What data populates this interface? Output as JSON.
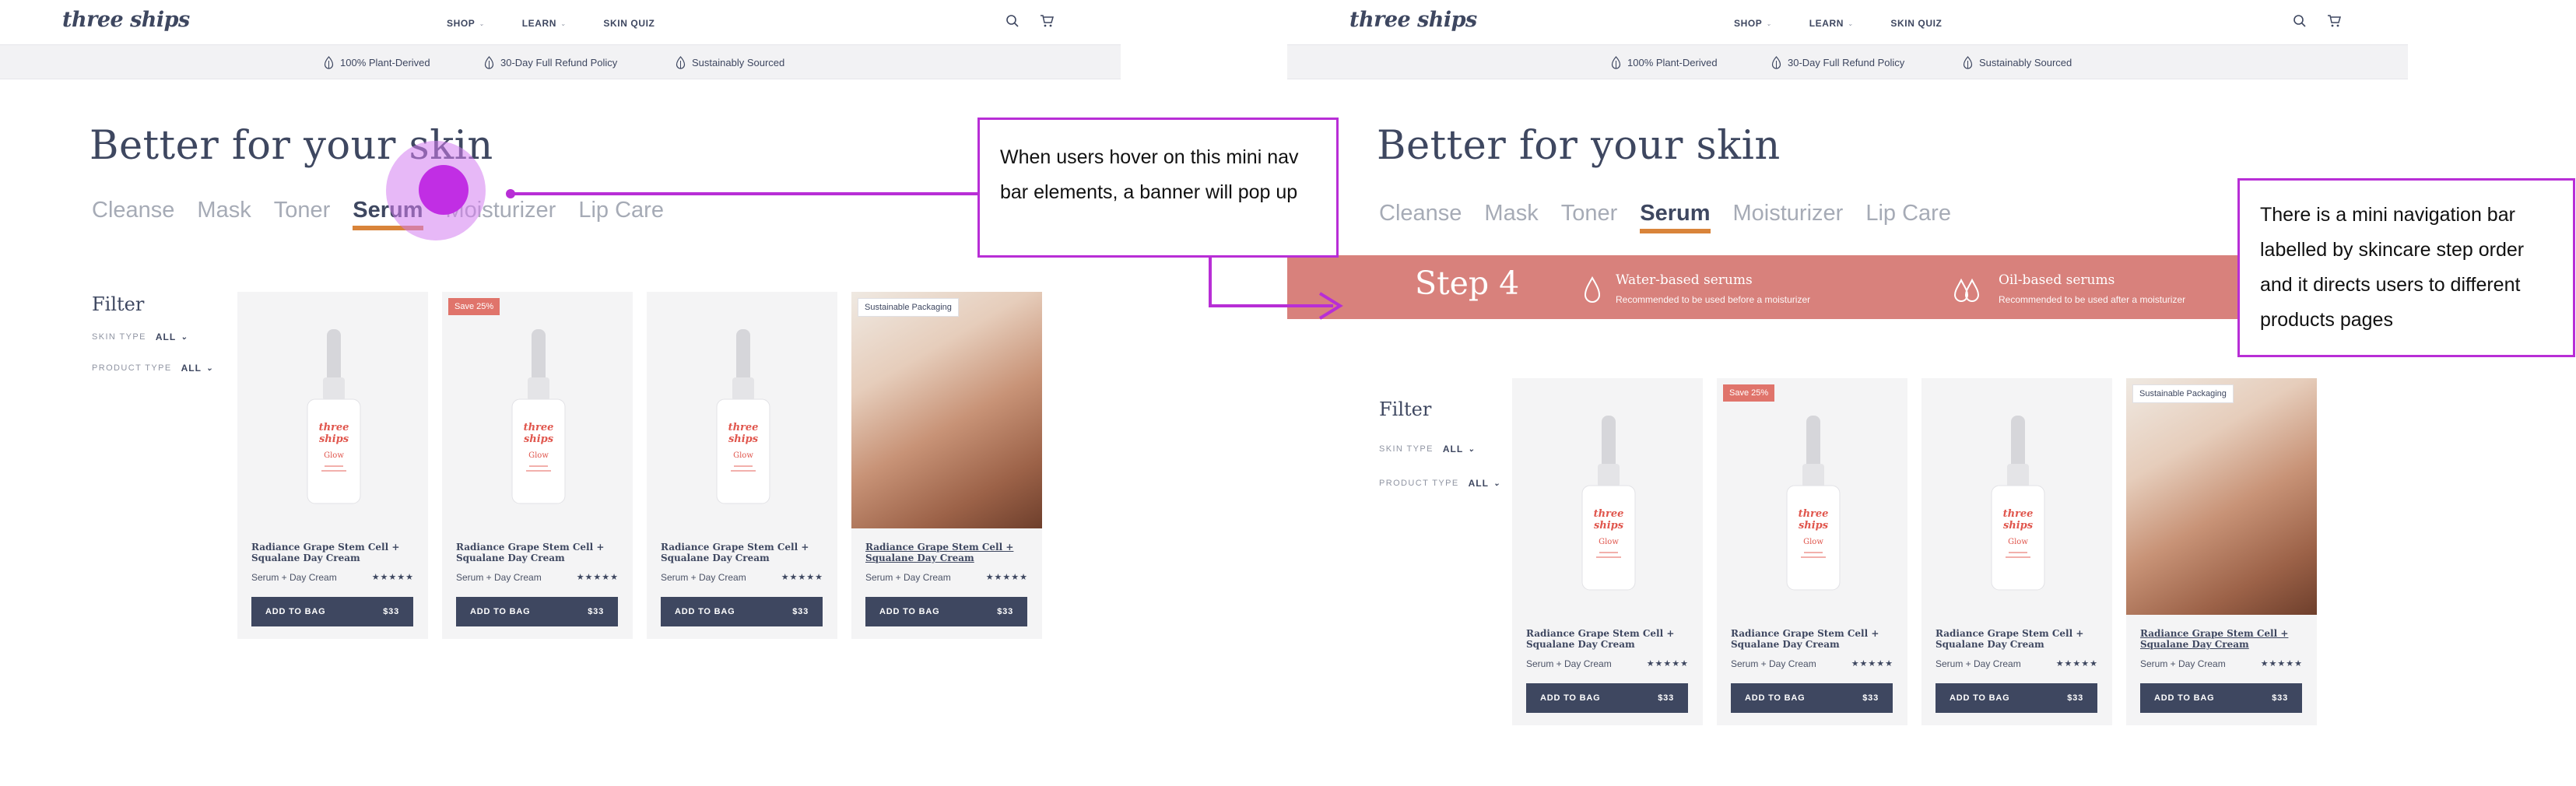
{
  "brand": "three ships",
  "nav": {
    "menu": [
      "SHOP",
      "LEARN",
      "SKIN QUIZ"
    ],
    "icons": [
      "search-icon",
      "cart-icon"
    ]
  },
  "benefits": [
    "100% Plant-Derived",
    "30-Day Full Refund Policy",
    "Sustainably Sourced"
  ],
  "page_title": "Better for your skin",
  "tabs": [
    "Cleanse",
    "Mask",
    "Toner",
    "Serum",
    "Moisturizer",
    "Lip Care"
  ],
  "active_tab": "Serum",
  "filter": {
    "title": "Filter",
    "skin_type_label": "SKIN TYPE",
    "skin_type_value": "ALL",
    "product_type_label": "PRODUCT TYPE",
    "product_type_value": "ALL"
  },
  "products": [
    {
      "badge": "",
      "title": "Radiance Grape Stem Cell + Squalane Day Cream",
      "subtitle": "Serum + Day Cream",
      "stars": "★★★★★",
      "button": "ADD TO BAG",
      "price": "$33"
    },
    {
      "badge": "Save 25%",
      "title": "Radiance Grape Stem Cell + Squalane Day Cream",
      "subtitle": "Serum + Day Cream",
      "stars": "★★★★★",
      "button": "ADD TO BAG",
      "price": "$33"
    },
    {
      "badge": "",
      "title": "Radiance Grape Stem Cell + Squalane Day Cream",
      "subtitle": "Serum + Day Cream",
      "stars": "★★★★★",
      "button": "ADD TO BAG",
      "price": "$33"
    },
    {
      "badge": "Sustainable Packaging",
      "title": "Radiance Grape Stem Cell + Squalane Day Cream",
      "subtitle": "Serum + Day Cream",
      "stars": "★★★★★",
      "button": "ADD TO BAG",
      "price": "$33"
    }
  ],
  "bottle_label": {
    "brand_line1": "three",
    "brand_line2": "ships",
    "name": "Glow"
  },
  "banner": {
    "step": "Step 4",
    "items": [
      {
        "name": "Water-based serums",
        "desc": "Recommended to be used before a moisturizer"
      },
      {
        "name": "Oil-based serums",
        "desc": "Recommended to be used after a moisturizer"
      }
    ]
  },
  "annotations": {
    "hover_note": "When users hover on this mini nav bar elements, a banner will pop up",
    "nav_note": "There is a mini navigation bar labelled by skincare step order and it directs users to different products pages"
  },
  "colors": {
    "accent_underline": "#d9843a",
    "navy": "#3e4760",
    "banner": "#d8817c",
    "annotation": "#b82ed6",
    "badge_sale": "#e0746b"
  }
}
